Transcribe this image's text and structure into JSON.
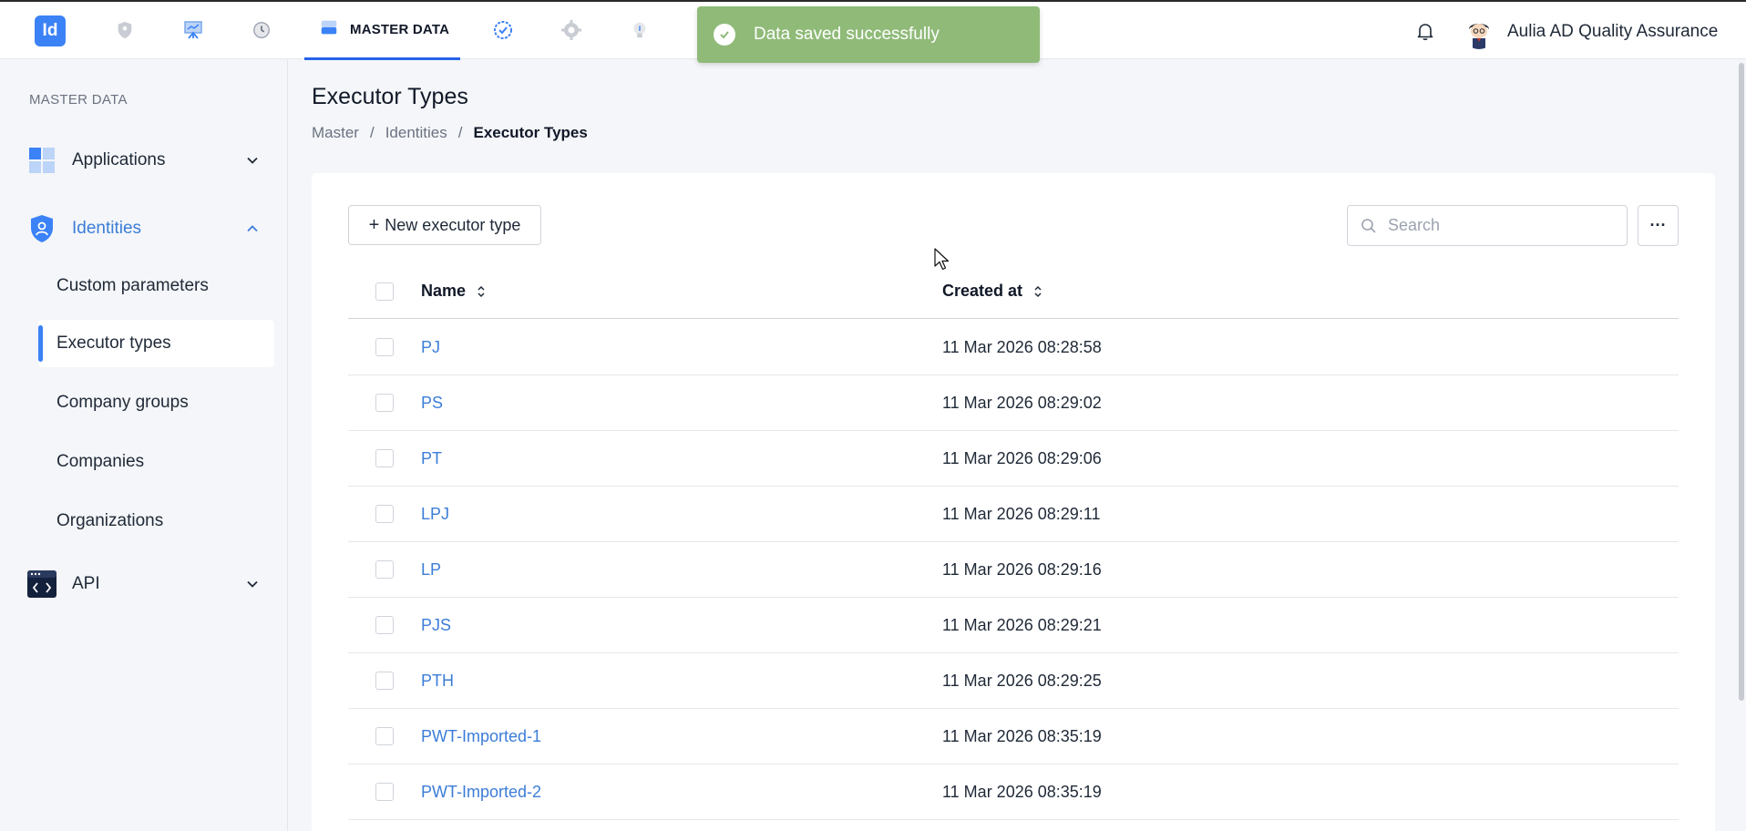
{
  "app": {
    "logo_text": "Id",
    "brand_color": "#3b82f6"
  },
  "topnav": {
    "items": [
      {
        "icon": "shield-icon"
      },
      {
        "icon": "presentation-icon"
      },
      {
        "icon": "history-icon"
      },
      {
        "icon": "database-icon",
        "label": "MASTER DATA",
        "active": true
      },
      {
        "icon": "check-circle-icon"
      },
      {
        "icon": "gear-icon"
      },
      {
        "icon": "lightbulb-icon"
      }
    ]
  },
  "toast": {
    "message": "Data saved successfully",
    "color": "#8fba78"
  },
  "user": {
    "name": "Aulia AD Quality Assurance"
  },
  "sidebar": {
    "section_title": "MASTER DATA",
    "groups": [
      {
        "label": "Applications",
        "icon": "grid-icon",
        "expanded": false
      },
      {
        "label": "Identities",
        "icon": "shield-user-icon",
        "expanded": true,
        "active": true
      },
      {
        "label": "API",
        "icon": "code-window-icon",
        "expanded": false
      }
    ],
    "identity_items": [
      {
        "label": "Custom parameters"
      },
      {
        "label": "Executor types",
        "active": true
      },
      {
        "label": "Company groups"
      },
      {
        "label": "Companies"
      },
      {
        "label": "Organizations"
      }
    ]
  },
  "page": {
    "title": "Executor Types",
    "breadcrumb": [
      "Master",
      "Identities",
      "Executor Types"
    ]
  },
  "toolbar": {
    "new_button": "New executor type",
    "search_placeholder": "Search",
    "more_label": "···"
  },
  "table": {
    "columns": [
      "Name",
      "Created at"
    ],
    "rows": [
      {
        "name": "PJ",
        "created_at": "11 Mar 2026 08:28:58"
      },
      {
        "name": "PS",
        "created_at": "11 Mar 2026 08:29:02"
      },
      {
        "name": "PT",
        "created_at": "11 Mar 2026 08:29:06"
      },
      {
        "name": "LPJ",
        "created_at": "11 Mar 2026 08:29:11"
      },
      {
        "name": "LP",
        "created_at": "11 Mar 2026 08:29:16"
      },
      {
        "name": "PJS",
        "created_at": "11 Mar 2026 08:29:21"
      },
      {
        "name": "PTH",
        "created_at": "11 Mar 2026 08:29:25"
      },
      {
        "name": "PWT-Imported-1",
        "created_at": "11 Mar 2026 08:35:19"
      },
      {
        "name": "PWT-Imported-2",
        "created_at": "11 Mar 2026 08:35:19"
      }
    ]
  }
}
